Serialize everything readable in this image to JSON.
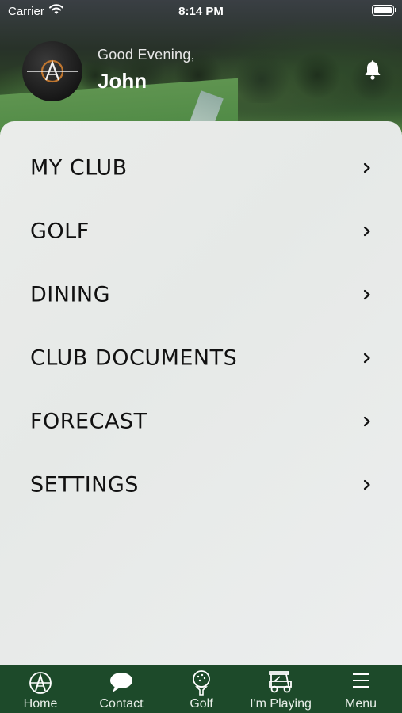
{
  "status_bar": {
    "carrier": "Carrier",
    "time": "8:14 PM"
  },
  "header": {
    "greeting": "Good Evening,",
    "user_name": "John",
    "logo_letter": "A"
  },
  "menu": {
    "items": [
      {
        "label": "MY CLUB"
      },
      {
        "label": "GOLF"
      },
      {
        "label": "DINING"
      },
      {
        "label": "CLUB DOCUMENTS"
      },
      {
        "label": "FORECAST"
      },
      {
        "label": "SETTINGS"
      }
    ]
  },
  "tab_bar": {
    "tabs": [
      {
        "label": "Home",
        "icon": "club-logo-icon"
      },
      {
        "label": "Contact",
        "icon": "chat-bubble-icon"
      },
      {
        "label": "Golf",
        "icon": "golf-ball-tee-icon"
      },
      {
        "label": "I'm Playing",
        "icon": "golf-cart-icon"
      },
      {
        "label": "Menu",
        "icon": "hamburger-menu-icon"
      }
    ]
  },
  "colors": {
    "tab_bar_bg": "#1d4a2a",
    "logo_accent": "#c0762f"
  }
}
